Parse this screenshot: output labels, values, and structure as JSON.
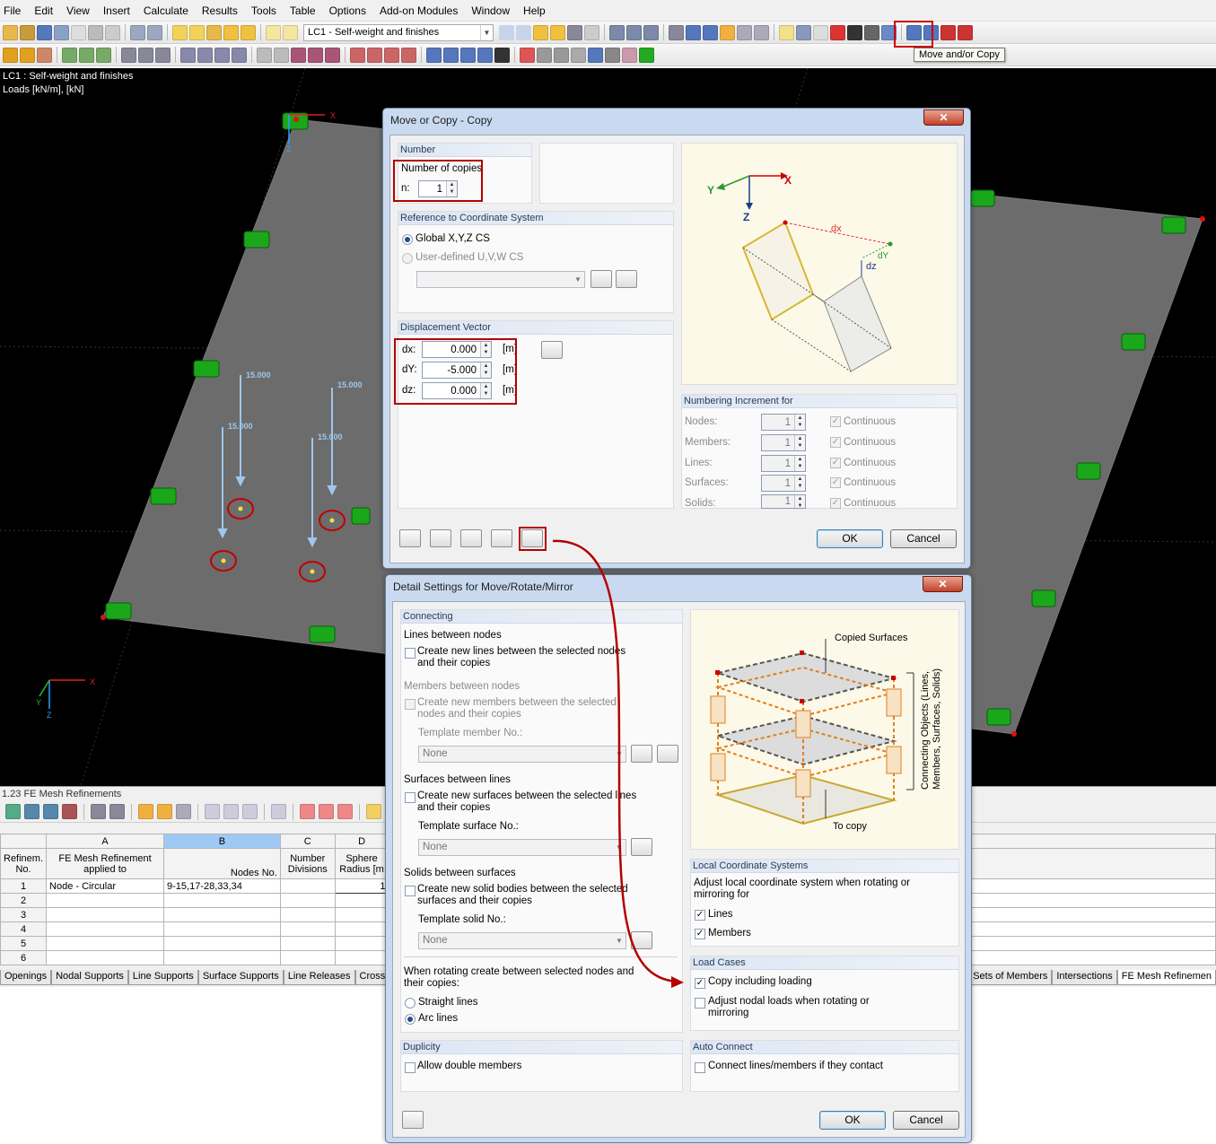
{
  "menu": [
    "File",
    "Edit",
    "View",
    "Insert",
    "Calculate",
    "Results",
    "Tools",
    "Table",
    "Options",
    "Add-on Modules",
    "Window",
    "Help"
  ],
  "toolbar": {
    "loadcase": "LC1 - Self-weight and finishes",
    "tooltip": "Move and/or Copy"
  },
  "viewport": {
    "info_line1": "LC1 : Self-weight and finishes",
    "info_line2": "Loads [kN/m], [kN]",
    "load_value": "15.000",
    "axis_x": "X",
    "axis_y": "Y",
    "axis_z": "Z"
  },
  "table": {
    "title": "1.23 FE Mesh Refinements",
    "col_letters": [
      "A",
      "B",
      "C",
      "D"
    ],
    "headers": [
      "Refinem. No.",
      "FE Mesh Refinement applied to",
      "Nodes No.",
      "Number Divisions",
      "Sphere Radius [m",
      "nt"
    ],
    "rows": [
      {
        "no": "1",
        "applied": "Node - Circular",
        "nodes": "9-15,17-28,33,34",
        "div": "",
        "radius": "1"
      },
      {
        "no": "2"
      },
      {
        "no": "3"
      },
      {
        "no": "4"
      },
      {
        "no": "5"
      },
      {
        "no": "6"
      }
    ],
    "tabs_left": [
      "Openings",
      "Nodal Supports",
      "Line Supports",
      "Surface Supports",
      "Line Releases",
      "Cross-Se"
    ],
    "tabs_right": [
      "es",
      "Sets of Members",
      "Intersections",
      "FE Mesh Refinemen"
    ]
  },
  "copy_dialog": {
    "title": "Move or Copy - Copy",
    "close": "✕",
    "number_group": "Number",
    "copies_label": "Number of copies",
    "n_label": "n:",
    "n_value": "1",
    "ref_group": "Reference to Coordinate System",
    "global": "Global X,Y,Z CS",
    "user_defined": "User-defined U,V,W CS",
    "disp_group": "Displacement Vector",
    "dx_label": "dx:",
    "dx": "0.000",
    "dy_label": "dY:",
    "dy": "-5.000",
    "dz_label": "dz:",
    "dz": "0.000",
    "unit": "[m]",
    "numbering_group": "Numbering Increment for",
    "numbering": [
      {
        "label": "Nodes:",
        "value": "1",
        "cont": "Continuous"
      },
      {
        "label": "Members:",
        "value": "1",
        "cont": "Continuous"
      },
      {
        "label": "Lines:",
        "value": "1",
        "cont": "Continuous"
      },
      {
        "label": "Surfaces:",
        "value": "1",
        "cont": "Continuous"
      },
      {
        "label": "Solids:",
        "value": "1",
        "cont": "Continuous"
      }
    ],
    "diagram": {
      "x": "X",
      "y": "Y",
      "z": "Z",
      "dx": "dx",
      "dy": "dY",
      "dz": "dz"
    },
    "ok": "OK",
    "cancel": "Cancel"
  },
  "detail_dialog": {
    "title": "Detail Settings for Move/Rotate/Mirror",
    "close": "✕",
    "connecting": "Connecting",
    "lines_between": "Lines between nodes",
    "lines_cb1": "Create new lines between the selected nodes",
    "lines_cb2": "and their copies",
    "members_between": "Members between nodes",
    "members_cb1": "Create new members between the selected",
    "members_cb2": "nodes and their copies",
    "template_member": "Template member No.:",
    "surfaces_between": "Surfaces between lines",
    "surfaces_cb1": "Create new surfaces between the selected lines",
    "surfaces_cb2": "and their copies",
    "template_surface": "Template surface No.:",
    "solids_between": "Solids between surfaces",
    "solids_cb1": "Create new solid bodies between the selected",
    "solids_cb2": "surfaces and their copies",
    "template_solid": "Template solid No.:",
    "none": "None",
    "rotate_text1": "When rotating create between selected nodes and",
    "rotate_text2": "their copies:",
    "straight": "Straight lines",
    "arc": "Arc lines",
    "duplicity": "Duplicity",
    "allow_double": "Allow double members",
    "diagram_copied": "Copied Surfaces",
    "diagram_connecting": "Connecting Objects (Lines,",
    "diagram_connecting2": "Members, Surfaces, Solids)",
    "diagram_tocopy": "To copy",
    "lcs": "Local Coordinate Systems",
    "lcs_text1": "Adjust local coordinate system when rotating or",
    "lcs_text2": "mirroring for",
    "lcs_lines": "Lines",
    "lcs_members": "Members",
    "loadcases": "Load Cases",
    "copy_loading": "Copy including loading",
    "adjust_nodal1": "Adjust nodal loads when rotating or",
    "adjust_nodal2": "mirroring",
    "auto_connect": "Auto Connect",
    "connect_lines": "Connect lines/members if they contact",
    "ok": "OK",
    "cancel": "Cancel"
  },
  "colors": {
    "highlight": "#b40000",
    "dialog_frame": "#c9daf0",
    "plate": "#6c6c6c",
    "support": "#18b418"
  }
}
